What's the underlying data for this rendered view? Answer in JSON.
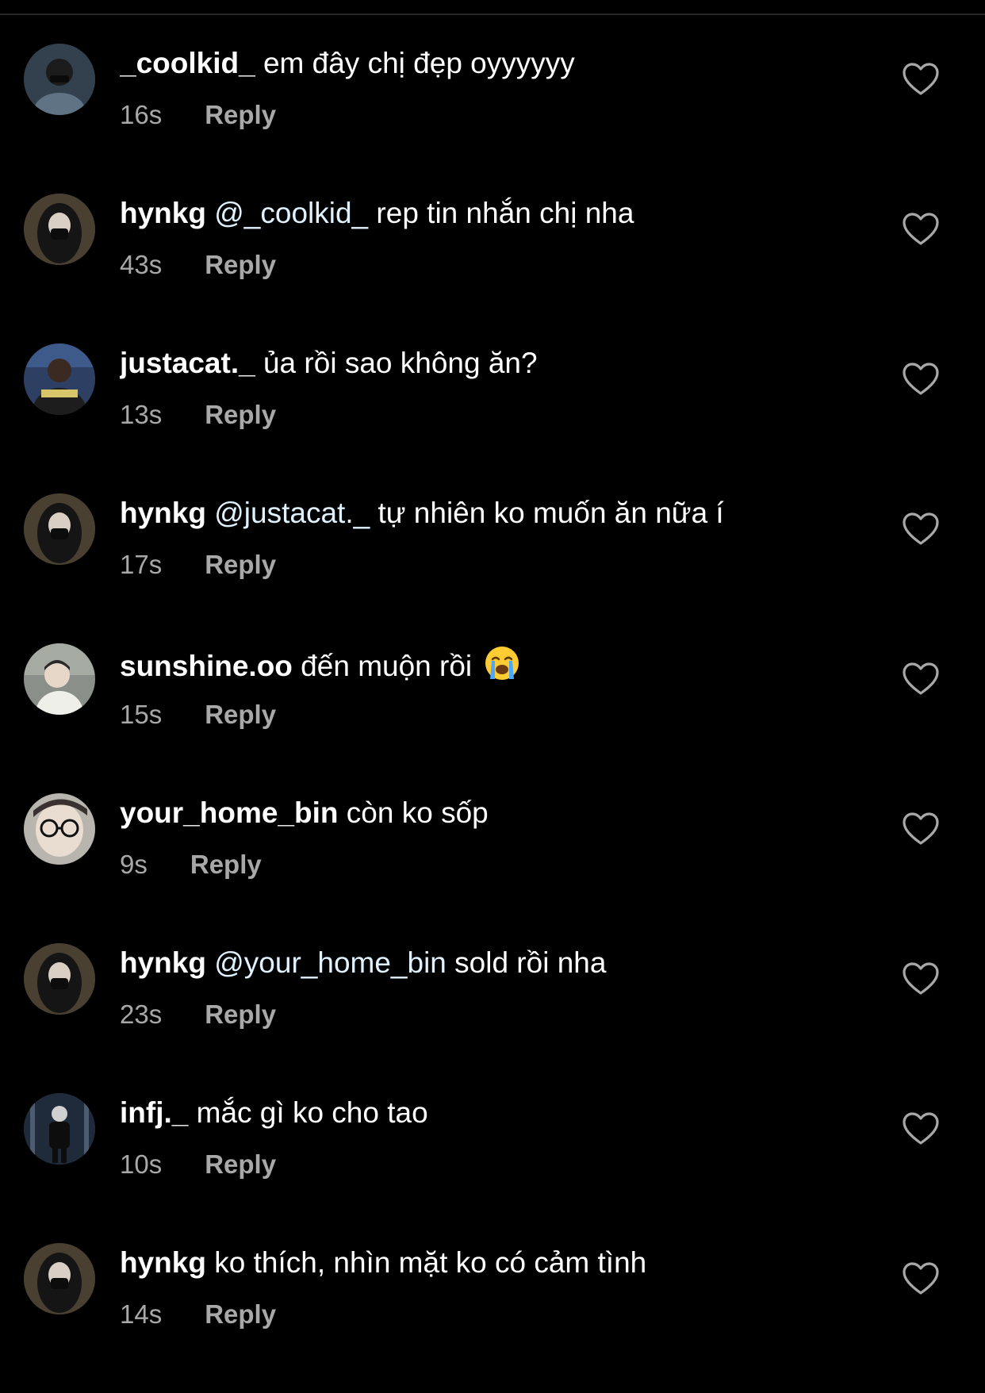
{
  "comments": [
    {
      "username": "_coolkid_",
      "mention": "",
      "text": " em đây chị đẹp oyyyyyy",
      "time": "16s",
      "reply_label": "Reply",
      "avatar_color": "#3a4a5a"
    },
    {
      "username": "hynkg",
      "mention": " @_coolkid_",
      "text": " rep tin nhắn chị nha",
      "time": "43s",
      "reply_label": "Reply",
      "avatar_color": "#4a4032"
    },
    {
      "username": "justacat._",
      "mention": "",
      "text": " ủa rồi sao không ăn?",
      "time": "13s",
      "reply_label": "Reply",
      "avatar_color": "#2d3f63"
    },
    {
      "username": "hynkg",
      "mention": " @justacat._",
      "text": " tự nhiên ko muốn ăn nữa í",
      "time": "17s",
      "reply_label": "Reply",
      "avatar_color": "#4a4032"
    },
    {
      "username": "sunshine.oo",
      "mention": "",
      "text": " đến muộn rồi ",
      "emoji": "loudly-crying-face-emoji",
      "time": "15s",
      "reply_label": "Reply",
      "avatar_color": "#8a8f8a"
    },
    {
      "username": "your_home_bin",
      "mention": "",
      "text": " còn ko sốp",
      "time": "9s",
      "reply_label": "Reply",
      "avatar_color": "#b8b4ae"
    },
    {
      "username": "hynkg",
      "mention": " @your_home_bin",
      "text": " sold rồi nha",
      "time": "23s",
      "reply_label": "Reply",
      "avatar_color": "#4a4032"
    },
    {
      "username": "infj._",
      "mention": "",
      "text": " mắc gì ko cho tao",
      "time": "10s",
      "reply_label": "Reply",
      "avatar_color": "#1f2a3a"
    },
    {
      "username": "hynkg",
      "mention": "",
      "text": " ko thích, nhìn mặt ko có cảm tình",
      "time": "14s",
      "reply_label": "Reply",
      "avatar_color": "#4a4032"
    }
  ],
  "colors": {
    "background": "#000000",
    "primary_text": "#ffffff",
    "secondary_text": "#a8a8a8",
    "mention": "#e0f1ff"
  },
  "icons": {
    "like": "heart-outline-icon",
    "avatar": "profile-photo"
  }
}
